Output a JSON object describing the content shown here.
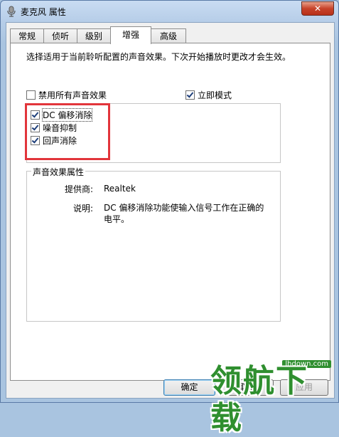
{
  "window": {
    "title": "麦克风 属性",
    "close_glyph": "✕"
  },
  "tabs": [
    {
      "label": "常规",
      "active": false
    },
    {
      "label": "侦听",
      "active": false
    },
    {
      "label": "级别",
      "active": false
    },
    {
      "label": "增强",
      "active": true
    },
    {
      "label": "高级",
      "active": false
    }
  ],
  "enhancements": {
    "description": "选择适用于当前聆听配置的声音效果。下次开始播放时更改才会生效。",
    "disable_all": {
      "label": "禁用所有声音效果",
      "checked": false
    },
    "immediate_mode": {
      "label": "立即模式",
      "checked": true
    },
    "effects": [
      {
        "label": "DC 偏移消除",
        "checked": true
      },
      {
        "label": "噪音抑制",
        "checked": true
      },
      {
        "label": "回声消除",
        "checked": true
      }
    ]
  },
  "properties": {
    "title": "声音效果属性",
    "provider_label": "提供商:",
    "provider_value": "Realtek",
    "description_label": "说明:",
    "description_value": "DC 偏移消除功能使输入信号工作在正确的电平。"
  },
  "buttons": {
    "ok": "确定",
    "cancel": "取消",
    "apply": "应用"
  },
  "watermark": {
    "text": "领航下载",
    "url": "lhdown.com"
  },
  "colors": {
    "highlight": "#e2353b",
    "watermark": "#2f8f2f"
  }
}
